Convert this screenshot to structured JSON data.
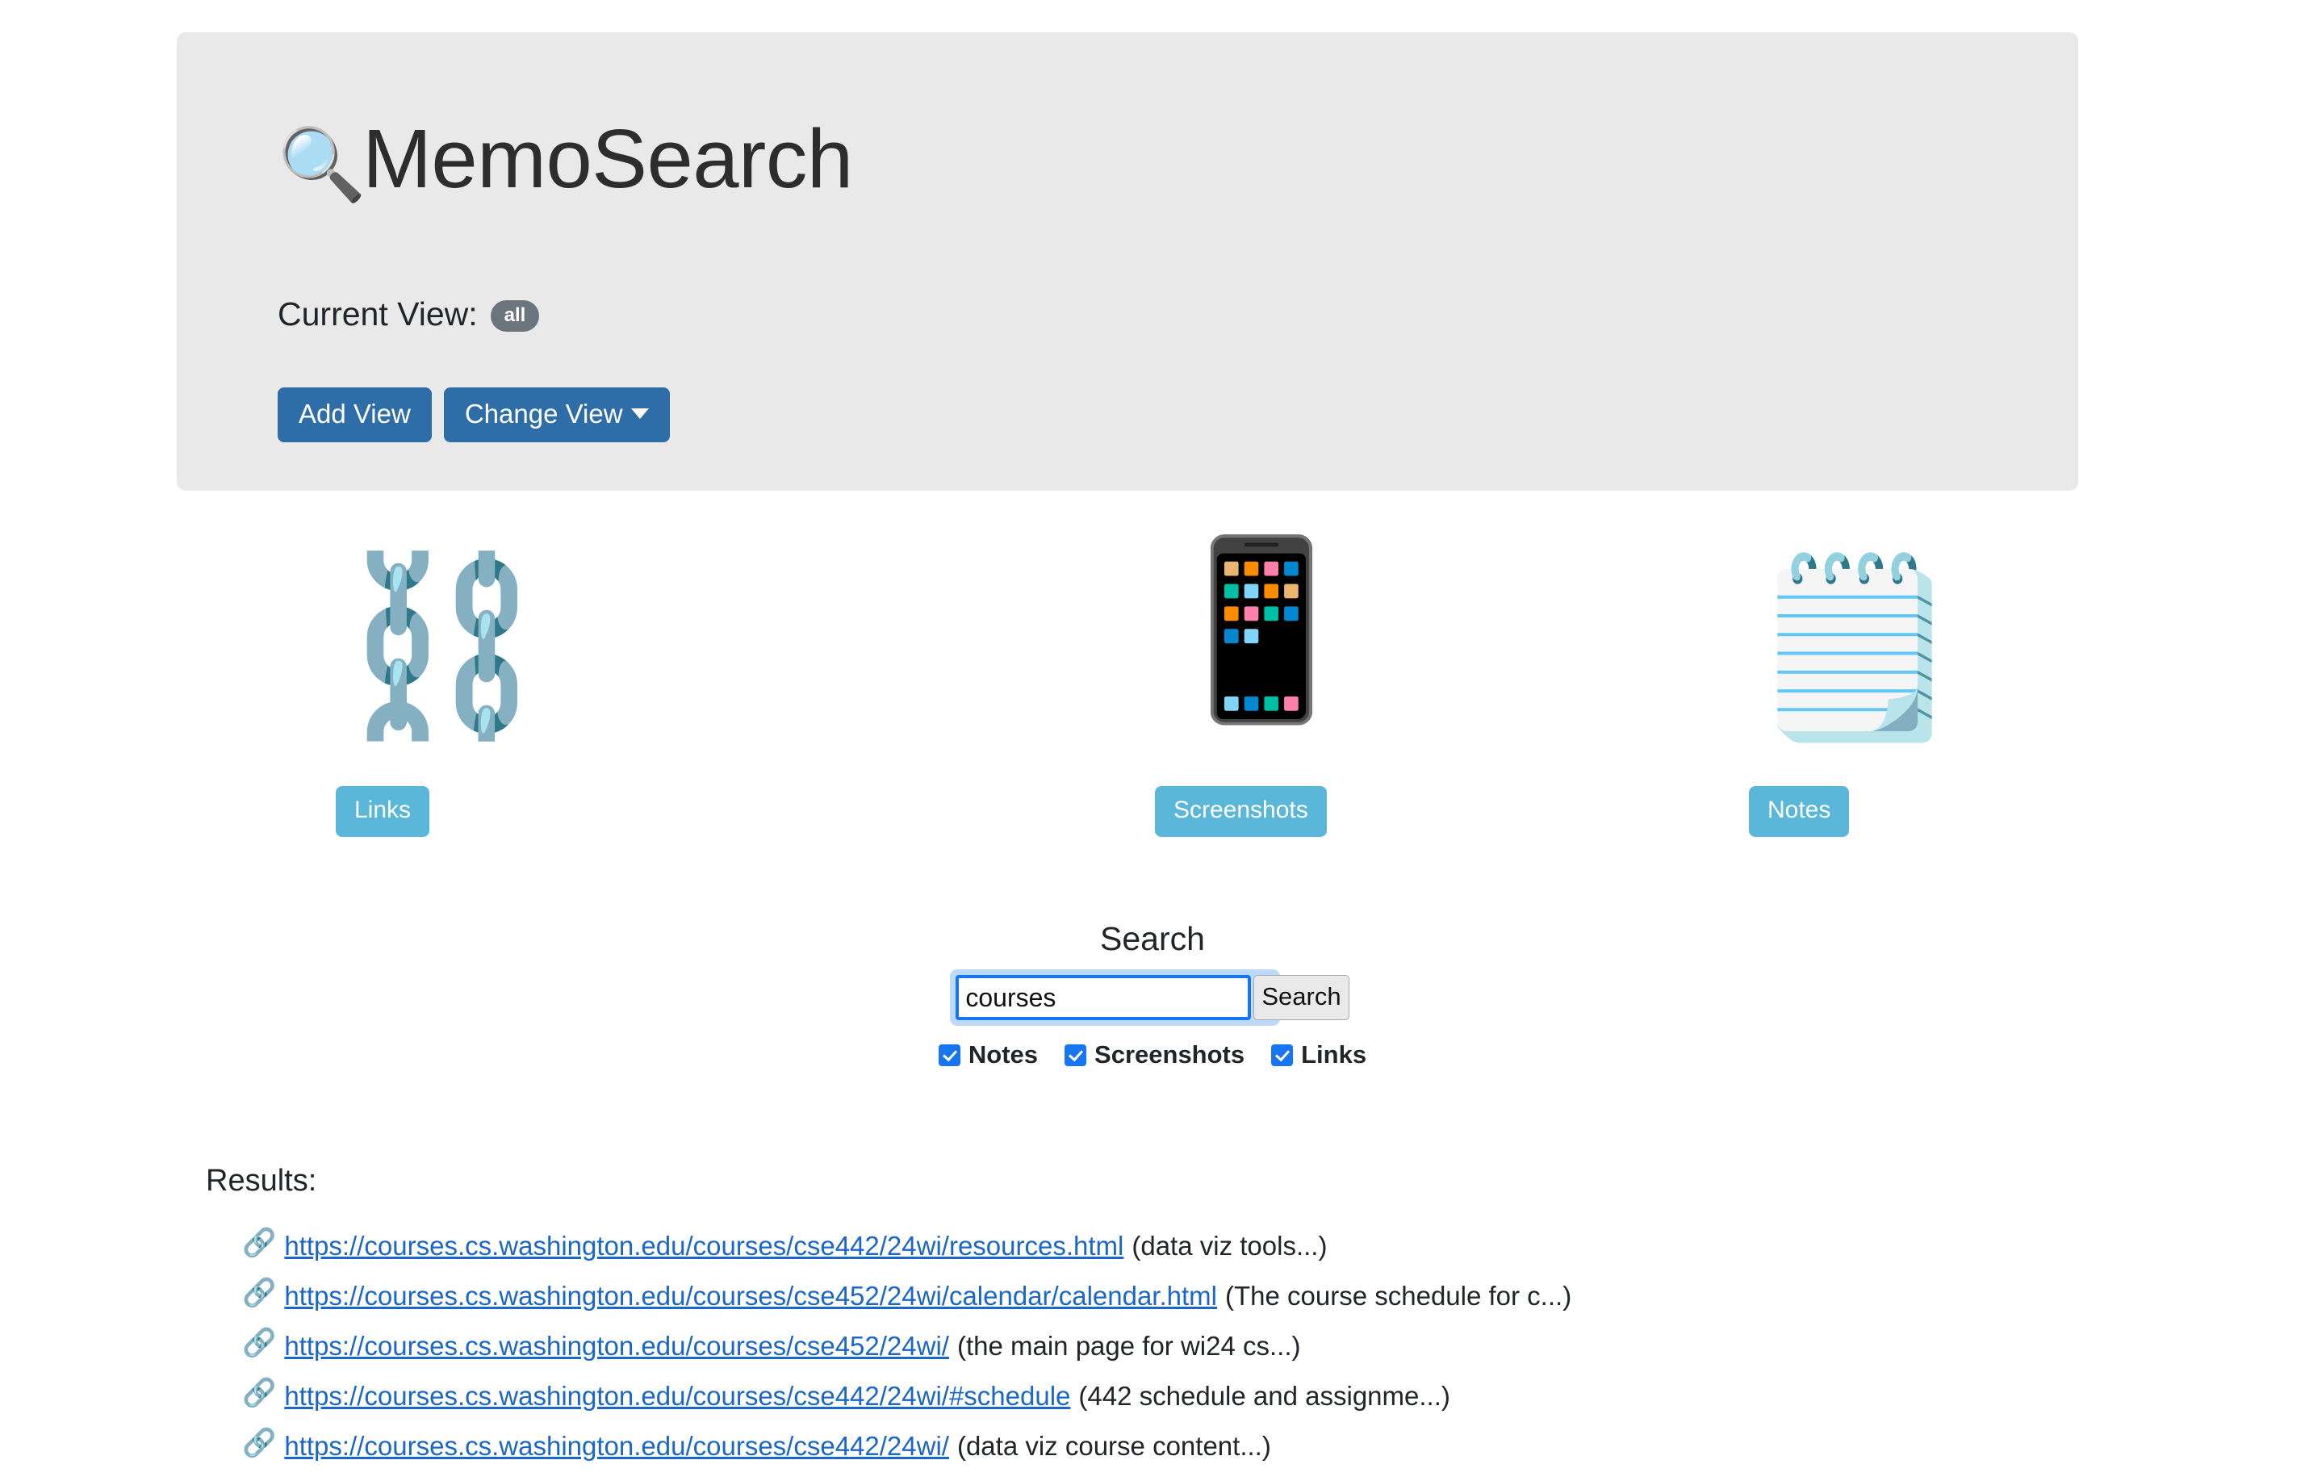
{
  "app": {
    "title": "MemoSearch",
    "logo_icon": "magnifying-glass-emoji"
  },
  "header": {
    "current_view_label": "Current View:",
    "current_view_value": "all",
    "add_view_label": "Add View",
    "change_view_label": "Change View",
    "accent_primary": "#2f6da8",
    "badge_color": "#6c757d",
    "panel_background": "#e9e9e9"
  },
  "categories": [
    {
      "emoji": "⛓️",
      "icon_name": "chains-emoji",
      "label": "Links"
    },
    {
      "emoji": "📱",
      "icon_name": "mobile-phone-emoji",
      "label": "Screenshots"
    },
    {
      "emoji": "🗒️",
      "icon_name": "note-on-clothespin-emoji",
      "label": "Notes"
    }
  ],
  "category_button_color": "#5bb7d9",
  "search": {
    "heading": "Search",
    "value": "courses",
    "placeholder": "",
    "submit_label": "Search",
    "filters": [
      {
        "label": "Notes",
        "checked": true
      },
      {
        "label": "Screenshots",
        "checked": true
      },
      {
        "label": "Links",
        "checked": true
      }
    ]
  },
  "results": {
    "heading": "Results:",
    "link_icon": "link-emoji",
    "items": [
      {
        "url": "https://courses.cs.washington.edu/courses/cse442/24wi/resources.html",
        "description": "(data viz tools...)"
      },
      {
        "url": "https://courses.cs.washington.edu/courses/cse452/24wi/calendar/calendar.html",
        "description": "(The course schedule for c...)"
      },
      {
        "url": "https://courses.cs.washington.edu/courses/cse452/24wi/",
        "description": "(the main page for wi24 cs...)"
      },
      {
        "url": "https://courses.cs.washington.edu/courses/cse442/24wi/#schedule",
        "description": "(442 schedule and assignme...)"
      },
      {
        "url": "https://courses.cs.washington.edu/courses/cse442/24wi/",
        "description": "(data viz course content...)"
      }
    ]
  },
  "colors": {
    "link": "#1b66c9",
    "checkbox_checked": "#1775f1",
    "input_focus_border": "#1775f1"
  }
}
